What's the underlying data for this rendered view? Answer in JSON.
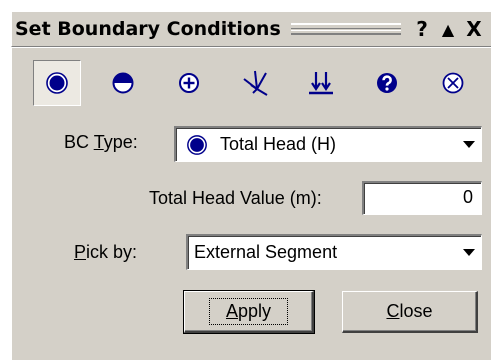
{
  "window": {
    "title": "Set Boundary Conditions",
    "help_glyph": "?",
    "collapse_glyph": "▲",
    "close_glyph": "X"
  },
  "toolbar": {
    "icons": [
      "total-head-icon",
      "pressure-head-icon",
      "unit-flux-icon",
      "nodal-flux-icon",
      "infiltration-icon",
      "unknown-icon",
      "no-flow-icon"
    ],
    "selected_index": 0
  },
  "bc_type": {
    "label_prefix": "BC ",
    "label_underlined": "T",
    "label_suffix": "ype:",
    "value": "Total Head (H)"
  },
  "total_head": {
    "label": "Total Head Value (m):",
    "value": "0"
  },
  "pick_by": {
    "label_underlined": "P",
    "label_suffix": "ick by:",
    "value": "External Segment"
  },
  "actions": {
    "apply_label": "Apply",
    "close_label": "Close"
  },
  "colors": {
    "face": "#d4d0c8",
    "icon_blue": "#00008b"
  }
}
